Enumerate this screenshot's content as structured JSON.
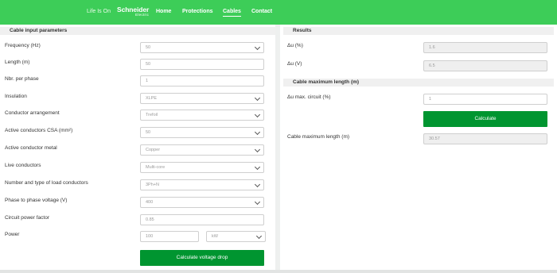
{
  "header": {
    "tagline": "Life Is On",
    "logo_line1": "Schneider",
    "logo_line2": "Electric",
    "nav": [
      "Home",
      "Protections",
      "Cables",
      "Contact"
    ]
  },
  "input_section": {
    "title": "Cable input parameters",
    "fields": {
      "frequency": {
        "label": "Frequency (Hz)",
        "value": "50"
      },
      "length": {
        "label": "Length (m)",
        "value": "50"
      },
      "nbr_per_phase": {
        "label": "Nbr. per phase",
        "value": "1"
      },
      "insulation": {
        "label": "Insulation",
        "value": "XLPE"
      },
      "conductor_arrangement": {
        "label": "Conductor arrangement",
        "value": "Trefoil"
      },
      "csa": {
        "label": "Active conductors CSA (mm²)",
        "value": "50"
      },
      "metal": {
        "label": "Active conductor metal",
        "value": "Copper"
      },
      "live_conductors": {
        "label": "Live conductors",
        "value": "Multi-core"
      },
      "load_conductors": {
        "label": "Number and type of load conductors",
        "value": "3Ph+N"
      },
      "voltage": {
        "label": "Phase to phase voltage (V)",
        "value": "400"
      },
      "power_factor": {
        "label": "Circuit power factor",
        "value": "0.85"
      },
      "power": {
        "label": "Power",
        "value": "100",
        "unit": "kW"
      }
    },
    "calc_button": "Calculate voltage drop"
  },
  "results_section": {
    "title": "Results",
    "du_percent": {
      "label": "Δu (%)",
      "value": "1.6"
    },
    "du_volts": {
      "label": "Δu (V)",
      "value": "6.5"
    }
  },
  "max_length_section": {
    "title": "Cable maximum length (m)",
    "du_max": {
      "label": "Δu max. circuit (%)",
      "value": "1"
    },
    "calc_button": "Calculate",
    "result": {
      "label": "Cable maximum length (m)",
      "value": "30.57"
    }
  }
}
